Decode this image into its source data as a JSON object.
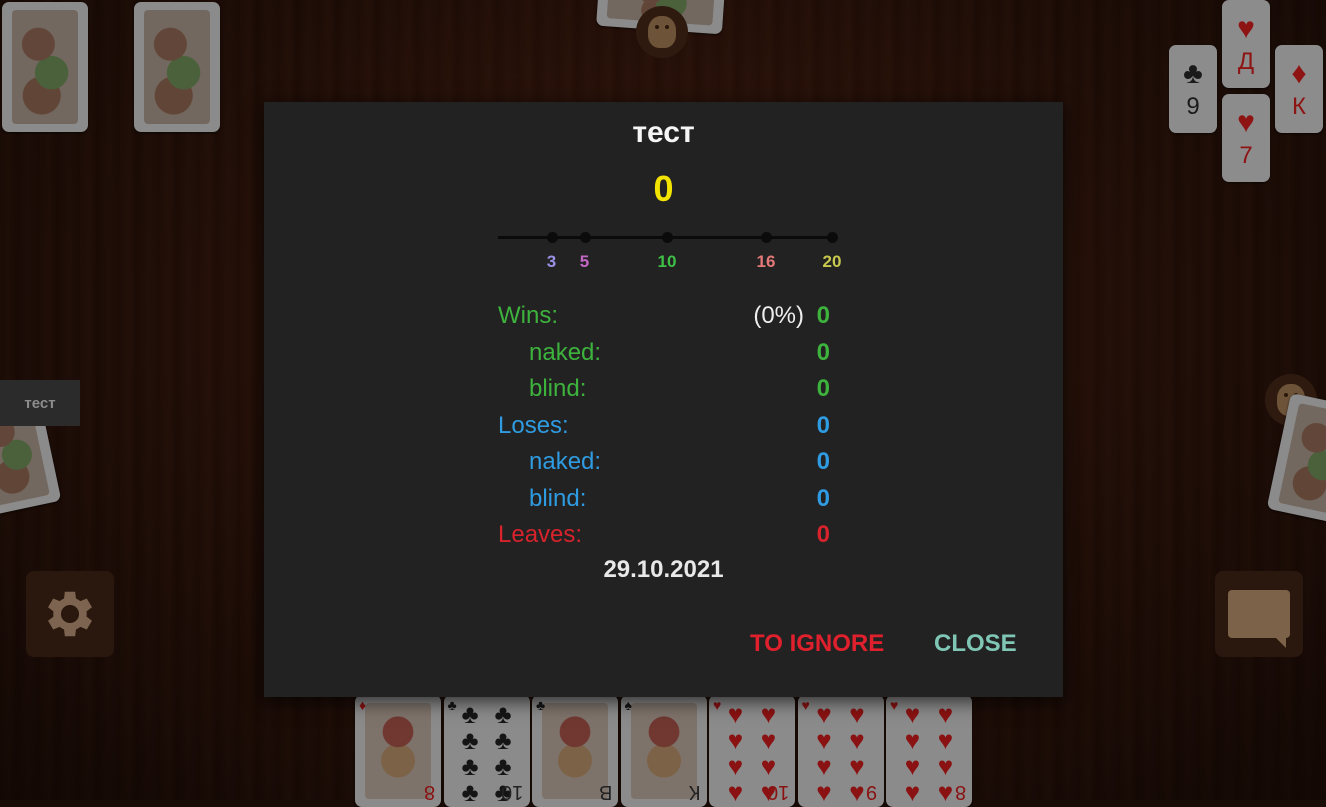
{
  "dialog": {
    "player_name": "тест",
    "rating": "0",
    "scale": {
      "ticks": [
        {
          "value": "3",
          "color": "#9a92e6"
        },
        {
          "value": "5",
          "color": "#c466c4"
        },
        {
          "value": "10",
          "color": "#3fc046"
        },
        {
          "value": "16",
          "color": "#e27878"
        },
        {
          "value": "20",
          "color": "#c9c84e"
        }
      ],
      "range": [
        0,
        20
      ]
    },
    "stats": {
      "wins_label": "Wins:",
      "wins_percent": "(0%)",
      "wins_value": "0",
      "wins_naked_label": "naked:",
      "wins_naked_value": "0",
      "wins_blind_label": "blind:",
      "wins_blind_value": "0",
      "loses_label": "Loses:",
      "loses_value": "0",
      "loses_naked_label": "naked:",
      "loses_naked_value": "0",
      "loses_blind_label": "blind:",
      "loses_blind_value": "0",
      "leaves_label": "Leaves:",
      "leaves_value": "0"
    },
    "date": "29.10.2021",
    "buttons": {
      "ignore": "TO IGNORE",
      "close": "CLOSE"
    },
    "colors": {
      "wins": "#3db33d",
      "loses": "#2f9be0",
      "leaves": "#d8222c",
      "rating": "#f2e400",
      "ignore": "#e0202c",
      "close": "#7fc6b5"
    }
  },
  "table": {
    "left_player_tag": "тест",
    "trump_cards": [
      {
        "suit": "♣",
        "rank": "9",
        "color": "black"
      },
      {
        "suit": "♥",
        "rank": "Д",
        "color": "red"
      },
      {
        "suit": "♥",
        "rank": "7",
        "color": "red"
      },
      {
        "suit": "♦",
        "rank": "К",
        "color": "red"
      }
    ],
    "hand": [
      {
        "suit": "♦",
        "rank": "8",
        "type": "face"
      },
      {
        "suit": "♣",
        "rank": "10",
        "type": "pips"
      },
      {
        "suit": "♣",
        "rank": "В",
        "type": "face"
      },
      {
        "suit": "♠",
        "rank": "К",
        "type": "face"
      },
      {
        "suit": "♥",
        "rank": "10",
        "type": "pips"
      },
      {
        "suit": "♥",
        "rank": "9",
        "type": "pips"
      },
      {
        "suit": "♥",
        "rank": "8",
        "type": "pips"
      }
    ]
  }
}
